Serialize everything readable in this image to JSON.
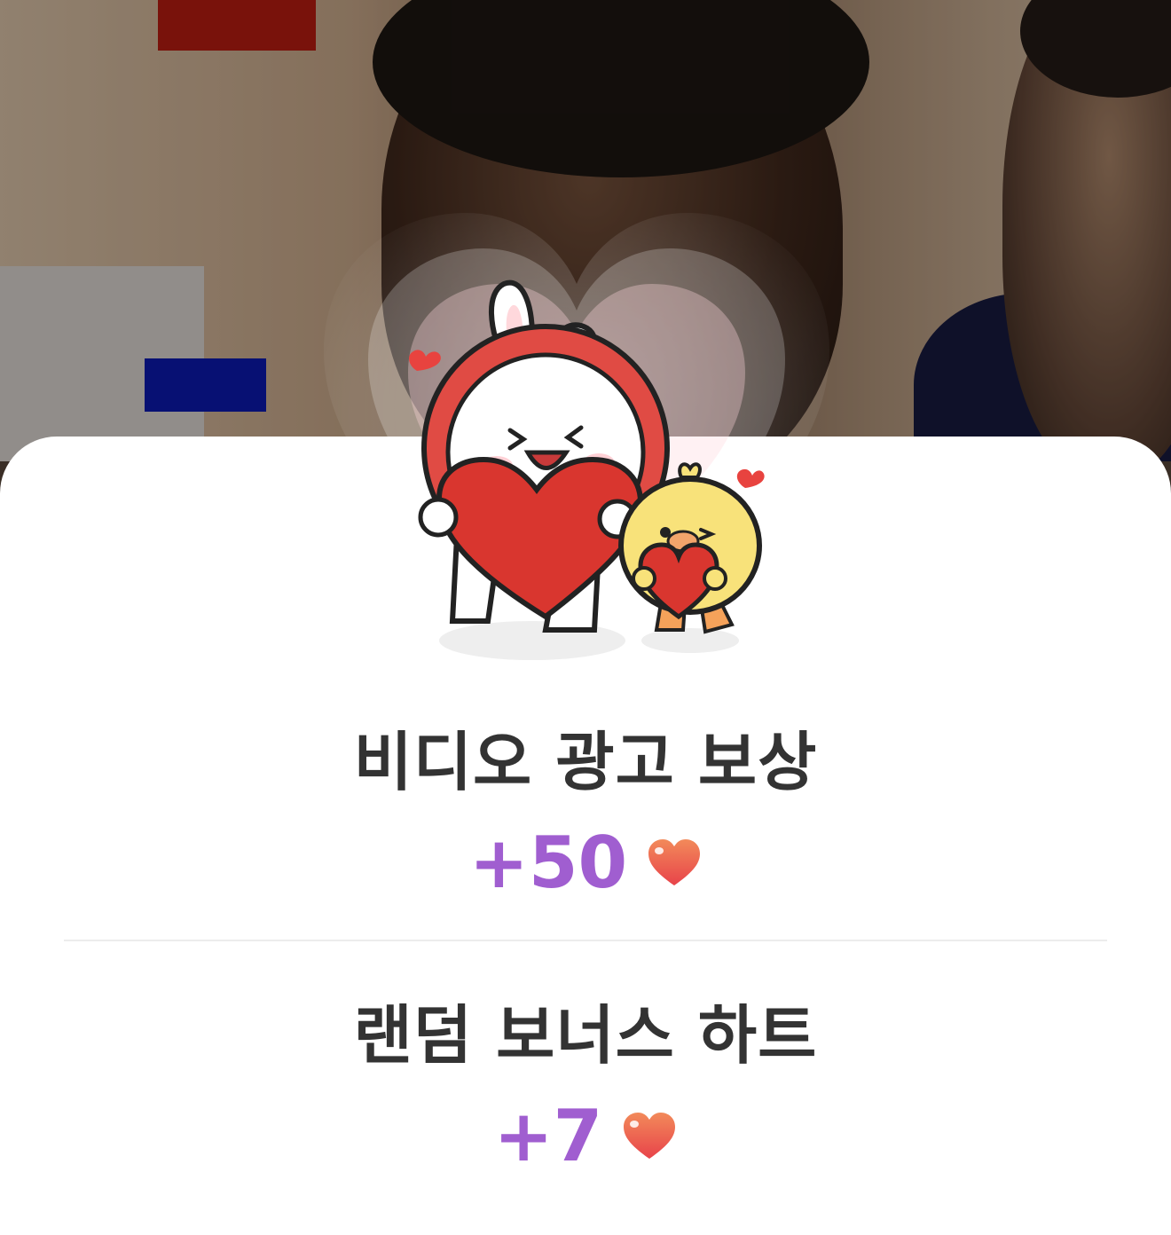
{
  "reward_popup": {
    "video_ad": {
      "title": "비디오 광고 보상",
      "amount": "+50"
    },
    "random_bonus": {
      "title": "랜덤 보너스 하트",
      "amount": "+7"
    }
  },
  "colors": {
    "title_text": "#333333",
    "amount_text": "#a05ed0",
    "heart_top": "#f28a5a",
    "heart_bottom": "#e8434a",
    "divider": "#ececec"
  },
  "icons": [
    "heart-icon",
    "bunny-chick-mascot"
  ]
}
